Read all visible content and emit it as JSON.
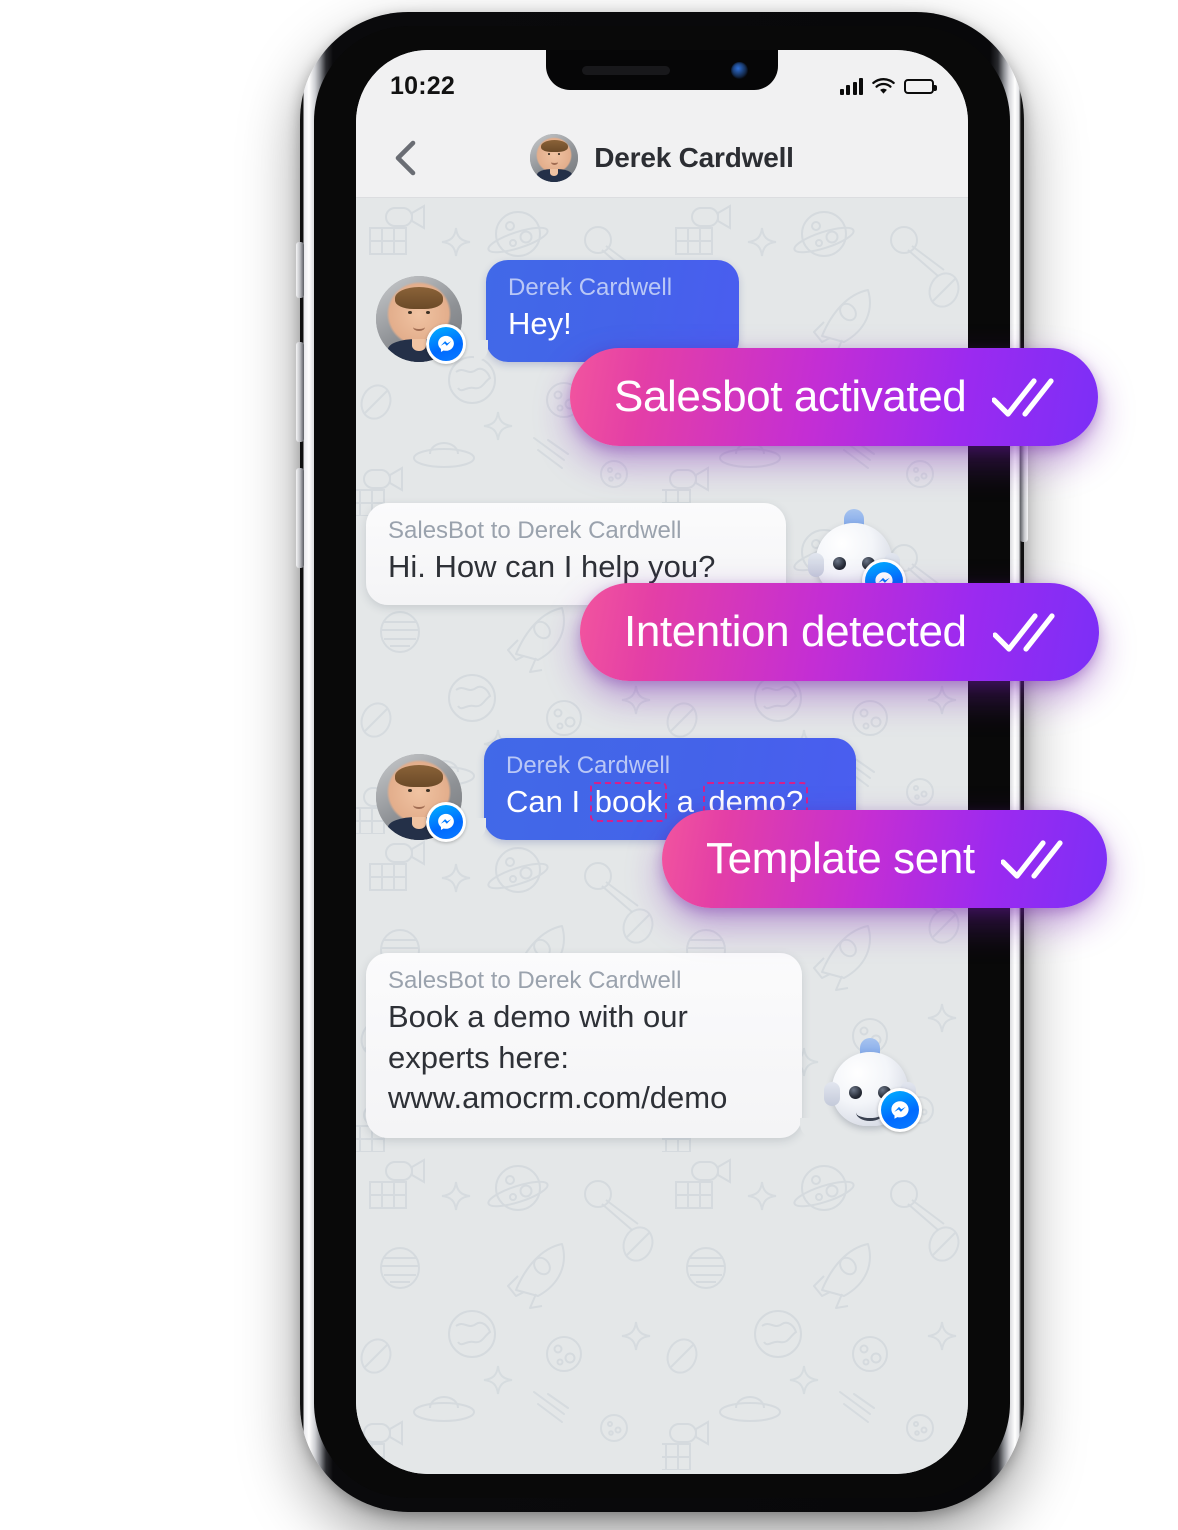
{
  "phone": {
    "status_bar": {
      "time": "10:22",
      "signal_icon": "cellular-signal-icon",
      "wifi_icon": "wifi-icon",
      "battery_icon": "battery-full-icon"
    },
    "buttons": {
      "mute_switch": "mute-switch",
      "volume_up": "volume-up-button",
      "volume_down": "volume-down-button",
      "power": "power-button"
    }
  },
  "header": {
    "back_icon": "chevron-left-icon",
    "avatar": "derek-cardwell-avatar",
    "title": "Derek Cardwell"
  },
  "chat": {
    "background_pattern": "space-doodles-pattern",
    "messages": [
      {
        "id": "msg-hey",
        "direction": "incoming",
        "sender": "Derek Cardwell",
        "text": "Hey!",
        "avatar": "derek-cardwell-avatar",
        "channel_badge": "facebook-messenger-icon"
      },
      {
        "id": "msg-bot-greeting",
        "direction": "outgoing",
        "sender": "SalesBot to Derek Cardwell",
        "text": "Hi. How can I help you?",
        "avatar": "salesbot-robot-avatar",
        "channel_badge": "facebook-messenger-icon"
      },
      {
        "id": "msg-book-demo",
        "direction": "incoming",
        "sender": "Derek Cardwell",
        "text_parts": [
          {
            "text": "Can I ",
            "highlighted": false
          },
          {
            "text": "book",
            "highlighted": true
          },
          {
            "text": " a ",
            "highlighted": false
          },
          {
            "text": "demo?",
            "highlighted": true
          }
        ],
        "text": "Can I book a demo?",
        "avatar": "derek-cardwell-avatar",
        "channel_badge": "facebook-messenger-icon"
      },
      {
        "id": "msg-bot-template",
        "direction": "outgoing",
        "sender": "SalesBot to Derek Cardwell",
        "text_line1": "Book a demo with our",
        "text_line2": "experts here:",
        "link": "www.amocrm.com/demo",
        "avatar": "salesbot-robot-avatar",
        "channel_badge": "facebook-messenger-icon"
      }
    ],
    "status_badges": [
      {
        "id": "badge-salesbot-activated",
        "label": "Salesbot activated",
        "icon": "double-check-icon"
      },
      {
        "id": "badge-intention-detected",
        "label": "Intention detected",
        "icon": "double-check-icon"
      },
      {
        "id": "badge-template-sent",
        "label": "Template sent",
        "icon": "double-check-icon"
      }
    ]
  },
  "colors": {
    "badge_gradient_start": "#f2559e",
    "badge_gradient_end": "#7b2ff7",
    "incoming_bubble": "#4169E8",
    "outgoing_bubble": "#f4f4f6",
    "link": "#4b68f0",
    "highlight_border": "#d61f8c",
    "chat_background": "#e4e7e8",
    "header_background": "#f1f1f2",
    "messenger_blue": "#0A7CFF"
  }
}
